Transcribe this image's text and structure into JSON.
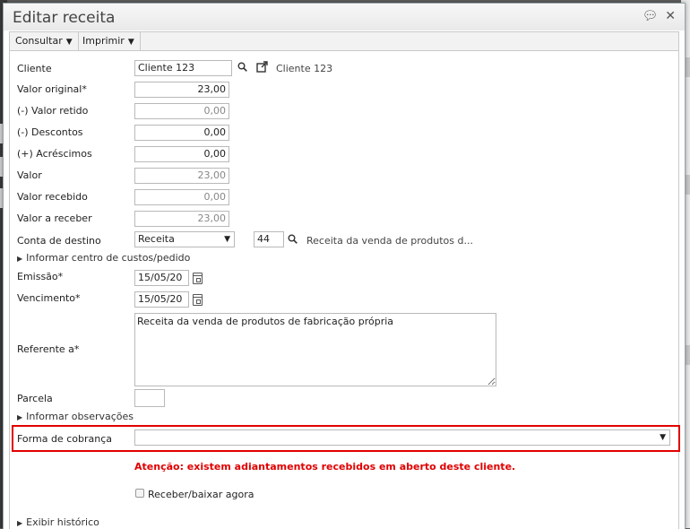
{
  "dialog": {
    "title": "Editar receita",
    "icons": {
      "comment": "comment-icon",
      "close": "close-icon"
    }
  },
  "menubar": {
    "consultar": "Consultar",
    "imprimir": "Imprimir"
  },
  "form": {
    "cliente": {
      "label": "Cliente",
      "value": "Cliente 123",
      "link_text": "Cliente 123"
    },
    "valor_original": {
      "label": "Valor original*",
      "value": "23,00"
    },
    "valor_retido": {
      "label": "(-) Valor retido",
      "value": "0,00"
    },
    "descontos": {
      "label": "(-) Descontos",
      "value": "0,00"
    },
    "acrescimos": {
      "label": "(+) Acréscimos",
      "value": "0,00"
    },
    "valor": {
      "label": "Valor",
      "value": "23,00"
    },
    "valor_recebido": {
      "label": "Valor recebido",
      "value": "0,00"
    },
    "valor_a_receber": {
      "label": "Valor a receber",
      "value": "23,00"
    },
    "conta_destino": {
      "label": "Conta de destino",
      "selected": "Receita",
      "code": "44",
      "description": "Receita da venda de produtos d..."
    },
    "centro_custos": "Informar centro de custos/pedido",
    "emissao": {
      "label": "Emissão*",
      "value": "15/05/20"
    },
    "vencimento": {
      "label": "Vencimento*",
      "value": "15/05/20"
    },
    "referente": {
      "label": "Referente a*",
      "value": "Receita da venda de produtos de fabricação própria"
    },
    "parcela": {
      "label": "Parcela",
      "value": ""
    },
    "observacoes": "Informar observações",
    "forma_cobranca": {
      "label": "Forma de cobrança",
      "selected": ""
    },
    "warning": "Atenção: existem adiantamentos recebidos em aberto deste cliente.",
    "receber_agora": "Receber/baixar agora",
    "historico": "Exibir histórico"
  },
  "colors": {
    "warning": "#e00000",
    "highlight_border": "#e00000"
  }
}
